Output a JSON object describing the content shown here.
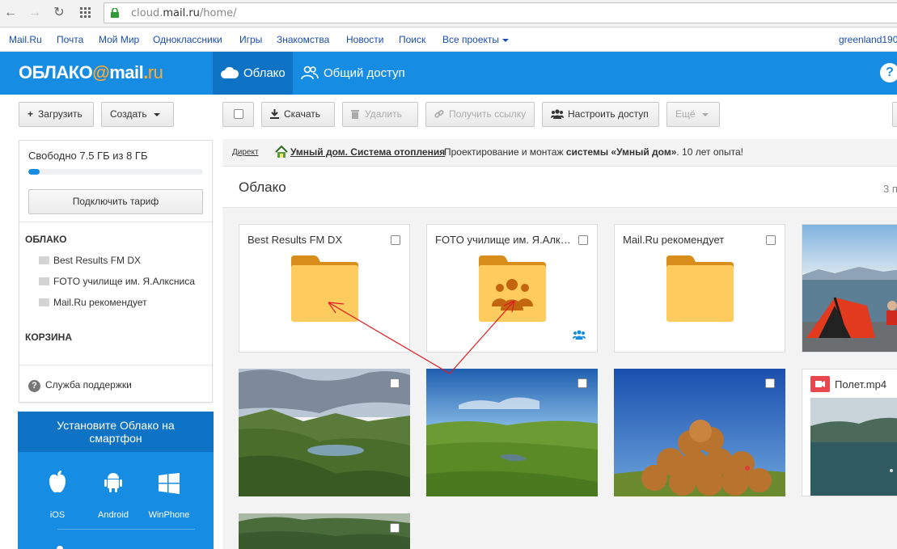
{
  "browser": {
    "url_prefix": "cloud.",
    "url_domain": "mail.ru",
    "url_path": "/home/"
  },
  "portal": {
    "links": [
      "Mail.Ru",
      "Почта",
      "Мой Мир",
      "Одноклассники",
      "Игры",
      "Знакомства",
      "Новости",
      "Поиск",
      "Все проекты"
    ],
    "user": "greenland190"
  },
  "header": {
    "logo_a": "ОБЛАКО",
    "logo_at": "@",
    "logo_b": "mail",
    "logo_dot": ".",
    "logo_ru": "ru",
    "tab_cloud": "Облако",
    "tab_shared": "Общий доступ",
    "help": "?"
  },
  "toolbar": {
    "upload": "Загрузить",
    "create": "Создать",
    "download": "Скачать",
    "delete": "Удалить",
    "get_link": "Получить ссылку",
    "access": "Настроить доступ",
    "more": "Ещё"
  },
  "sidebar": {
    "free_space": "Свободно 7.5 ГБ из 8 ГБ",
    "used_percent": 6.25,
    "tariff_button": "Подключить тариф",
    "cloud_heading": "ОБЛАКО",
    "folders": [
      "Best Results FM DX",
      "FOTO училище им. Я.Алксниса",
      "Mail.Ru рекомендует"
    ],
    "trash_heading": "КОРЗИНА",
    "support": "Служба поддержки"
  },
  "promo": {
    "title_line1": "Установите Облако на",
    "title_line2": "смартфон",
    "platforms": [
      "iOS",
      "Android",
      "WinPhone"
    ]
  },
  "ad": {
    "direct": "Директ",
    "title": "Умный дом. Система отопления",
    "desc_a": "Проектирование и монтаж ",
    "desc_b": "системы «Умный дом»",
    "desc_c": ". 10 лет опыта!"
  },
  "main": {
    "title": "Облако",
    "count": "3 п",
    "tiles": [
      {
        "name": "Best Results FM DX",
        "type": "folder"
      },
      {
        "name": "FOTO училище им. Я.Алксниса",
        "type": "shared-folder"
      },
      {
        "name": "Mail.Ru рекомендует",
        "type": "folder"
      }
    ],
    "video_name": "Полет.mp4"
  },
  "colors": {
    "brand_blue": "#168de2",
    "brand_dark_blue": "#0f73c5",
    "folder_yellow": "#fecb5f",
    "folder_tab": "#d98d1a",
    "annotation_red": "#e0191f"
  }
}
